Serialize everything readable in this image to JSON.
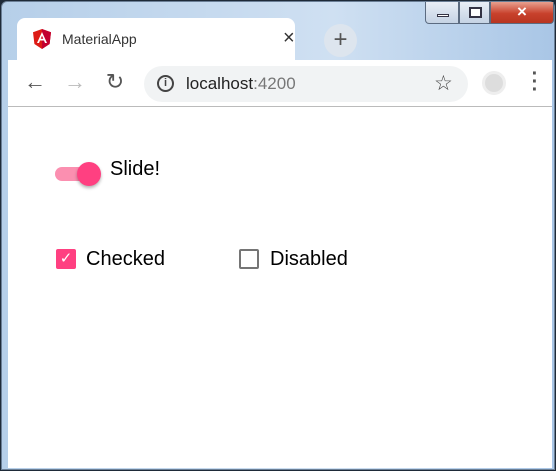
{
  "window": {
    "controls": {
      "minimize": "minimize",
      "maximize": "maximize",
      "close": "×"
    }
  },
  "tab": {
    "title": "MaterialApp",
    "close": "×",
    "favicon": "angular-logo"
  },
  "new_tab": "+",
  "toolbar": {
    "back": "←",
    "forward": "→",
    "reload": "↻",
    "url_host": "localhost",
    "url_port": ":4200",
    "info": "i",
    "star": "☆",
    "menu": "⋮"
  },
  "content": {
    "slide_toggle": {
      "label": "Slide!",
      "checked": true
    },
    "checkbox_checked": {
      "label": "Checked",
      "checked": true,
      "mark": "✓"
    },
    "checkbox_disabled": {
      "label": "Disabled",
      "checked": false
    }
  },
  "colors": {
    "accent": "#ff4081",
    "accent_light": "#fb8fb0"
  }
}
